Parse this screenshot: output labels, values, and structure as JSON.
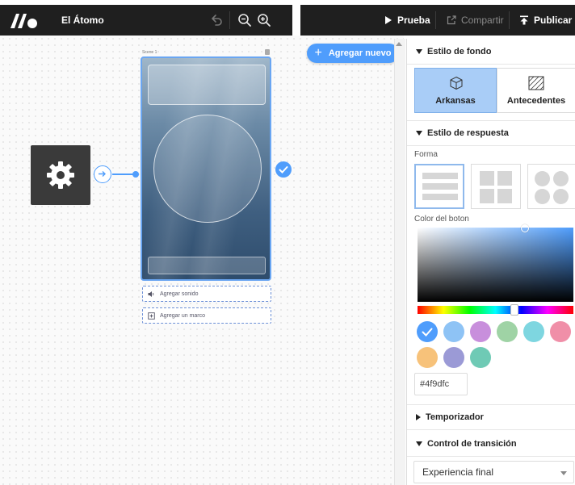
{
  "app": {
    "title": "El Átomo"
  },
  "toolbar": {
    "undo_icon": "undo-icon",
    "zoom_out_icon": "zoom-out-icon",
    "zoom_in_icon": "zoom-in-icon",
    "test_label": "Prueba",
    "share_label": "Compartir",
    "publish_label": "Publicar"
  },
  "canvas": {
    "add_new_label": "Agregar nuevo",
    "scene": {
      "name": "Scene 1",
      "add_sound_label": "Agregar sonido",
      "add_frame_label": "Agregar un marco"
    },
    "accent_color": "#4f9dfc"
  },
  "panel": {
    "background_style": {
      "title": "Estilo de fondo",
      "options": [
        {
          "label": "Arkansas",
          "icon": "cube-icon",
          "selected": true
        },
        {
          "label": "Antecedentes",
          "icon": "hatched-image-icon",
          "selected": false
        }
      ]
    },
    "answer_style": {
      "title": "Estilo de respuesta",
      "shape_label": "Forma",
      "shapes": [
        "list-layout",
        "grid-layout",
        "circle-layout"
      ],
      "selected_shape": "list-layout",
      "button_color_label": "Color del boton",
      "swatches": [
        "#4f9dfc",
        "#8ec3f5",
        "#c88fdc",
        "#9fd3a5",
        "#7ed6e0",
        "#f08fa8",
        "#f7c27a",
        "#9b9ad6",
        "#6fcab5"
      ],
      "selected_swatch": "#4f9dfc",
      "hex_value": "#4f9dfc"
    },
    "timer": {
      "title": "Temporizador"
    },
    "transition_control": {
      "title": "Control de transición",
      "selected_value": "Experiencia final"
    }
  }
}
